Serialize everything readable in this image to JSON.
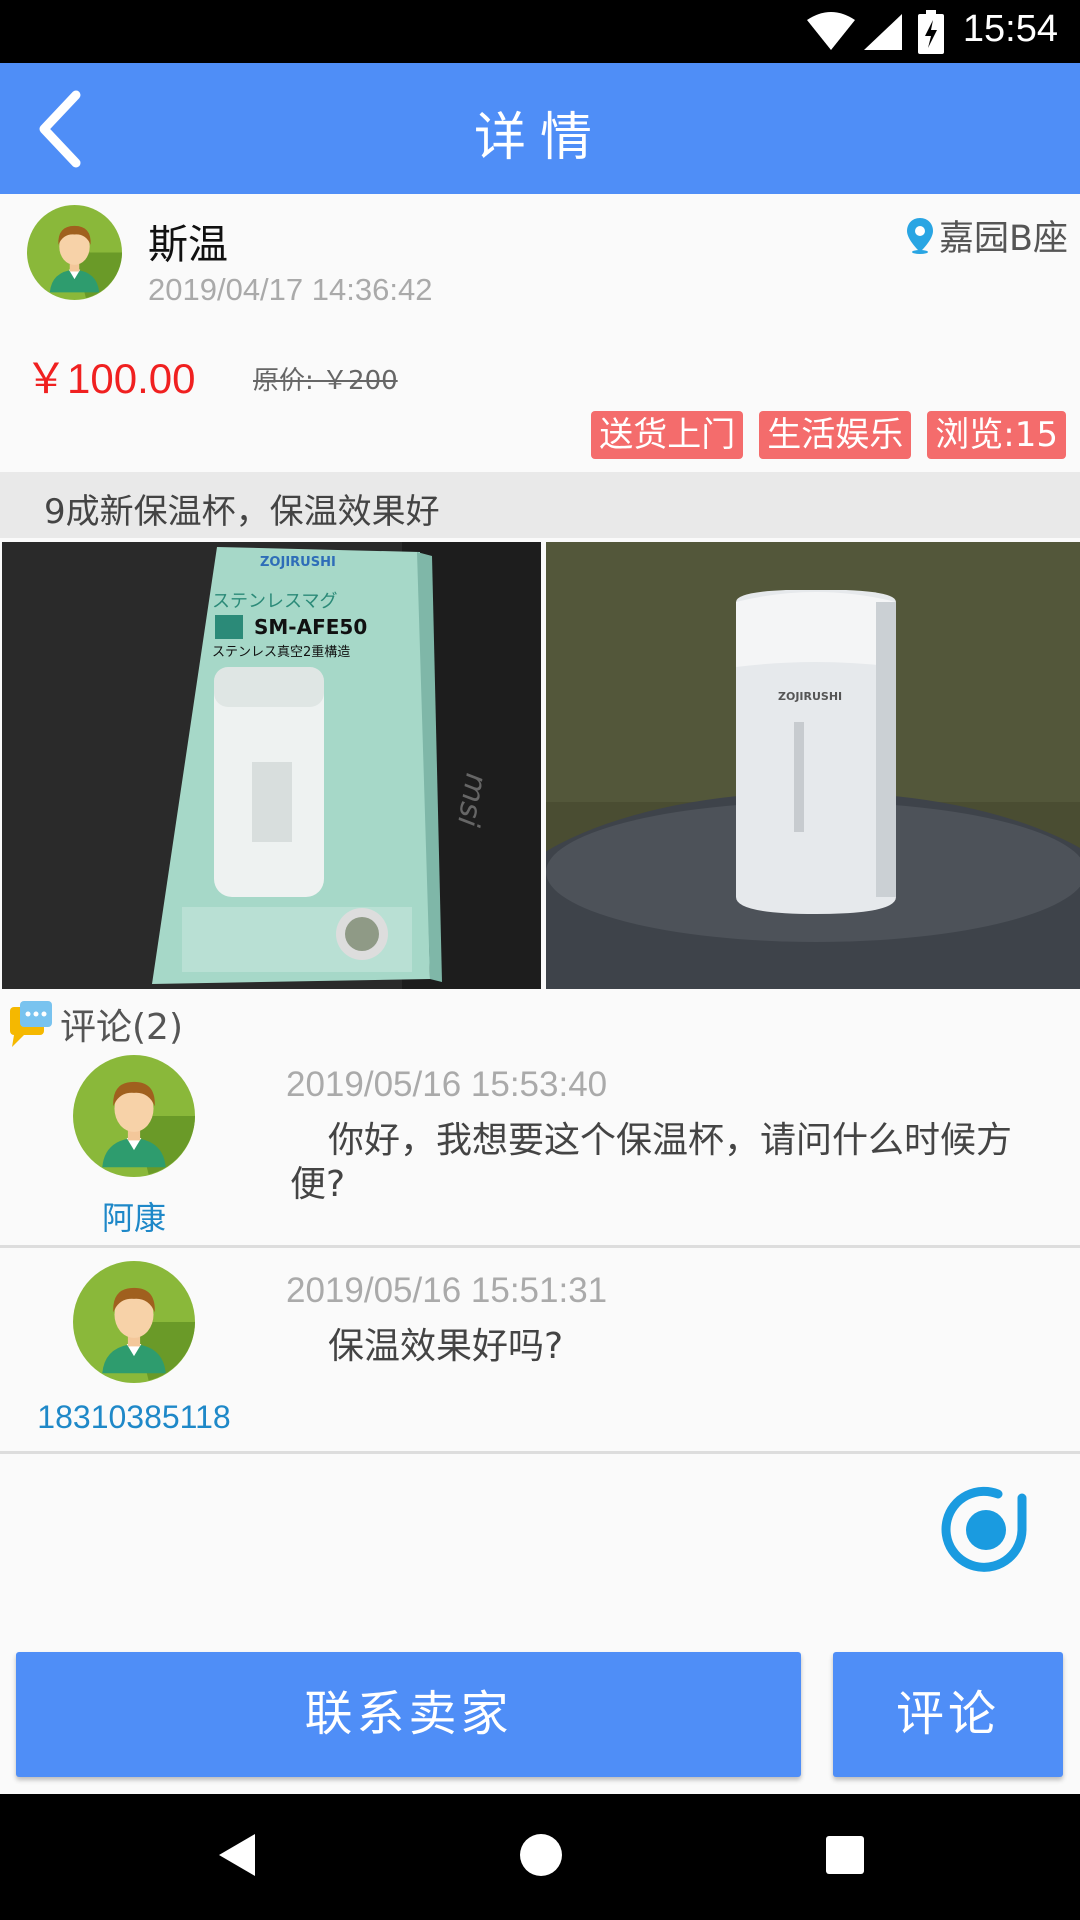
{
  "status_bar": {
    "time": "15:54"
  },
  "header": {
    "title": "详情"
  },
  "seller": {
    "name": "斯温",
    "time": "2019/04/17 14:36:42",
    "location": "嘉园B座"
  },
  "price": {
    "current": "￥100.00",
    "original": "原价: ￥200"
  },
  "tags": [
    "送货上门",
    "生活娱乐",
    "浏览:15"
  ],
  "description": "9成新保温杯，保温效果好",
  "comments": {
    "title": "评论(2)",
    "items": [
      {
        "user": "阿康",
        "time": "2019/05/16 15:53:40",
        "text": "你好，我想要这个保温杯，请问什么时候方便?"
      },
      {
        "user": "18310385118",
        "time": "2019/05/16 15:51:31",
        "text": "保温效果好吗?"
      }
    ]
  },
  "buttons": {
    "contact": "联系卖家",
    "comment": "评论"
  },
  "images": {
    "box_brand": "ZOJIRUSHI",
    "box_text1": "ステンレスマグ",
    "box_model": "SM-AFE50",
    "box_text2": "ステンレス真空2重構造",
    "laptop_logo": "msi",
    "cup_brand": "ZOJIRUSHI"
  },
  "colors": {
    "accent": "#4f8ef7",
    "price": "#f02020",
    "tag": "#f46c6c",
    "username": "#1e88c8"
  }
}
